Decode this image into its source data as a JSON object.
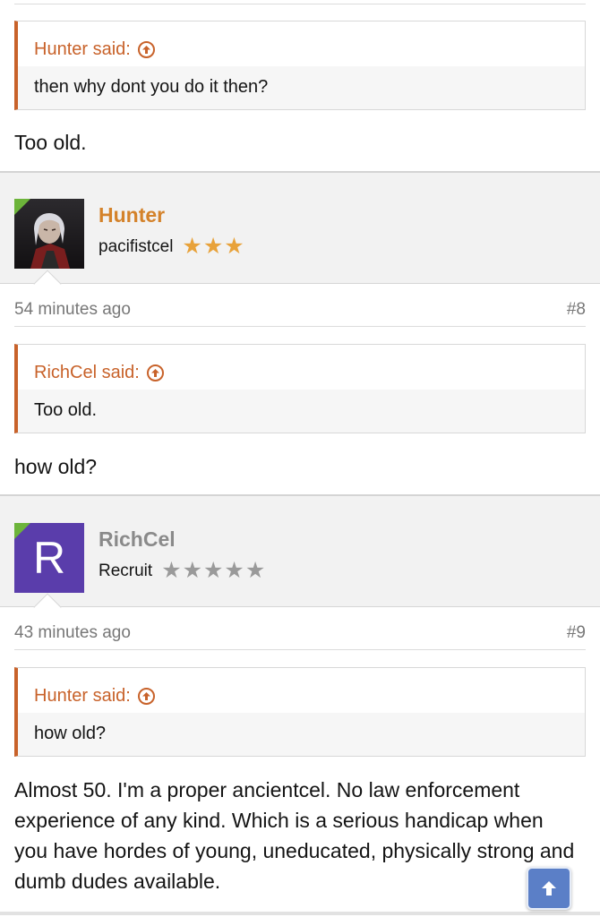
{
  "posts": [
    {
      "quote": {
        "author": "Hunter said:",
        "text": "then why dont you do it then?"
      },
      "message": "Too old."
    },
    {
      "user": {
        "name": "Hunter",
        "title": "pacifistcel",
        "stars": "★★★",
        "name_color": "#d4822a",
        "star_color": "#e8a23a"
      },
      "time": "54 minutes ago",
      "number": "#8",
      "quote": {
        "author": "RichCel said:",
        "text": "Too old."
      },
      "message": "how old?"
    },
    {
      "user": {
        "name": "RichCel",
        "title": "Recruit",
        "stars": "★★★★★",
        "avatar_letter": "R",
        "name_color": "#8a8a8a",
        "star_color": "#9a9a9a",
        "avatar_bg": "#5a3dab"
      },
      "time": "43 minutes ago",
      "number": "#9",
      "quote": {
        "author": "Hunter said:",
        "text": "how old?"
      },
      "message": "Almost 50. I'm a proper ancientcel. No law enforcement experience of any kind. Which is a serious handicap when you have hordes of young, uneducated, physically strong and dumb dudes available."
    }
  ],
  "icons": {
    "quote_jump": "arrow-up-circle-icon",
    "scroll_top": "arrow-up-icon"
  },
  "colors": {
    "accent": "#c8622a",
    "scroll_button": "#5b7fc7"
  }
}
